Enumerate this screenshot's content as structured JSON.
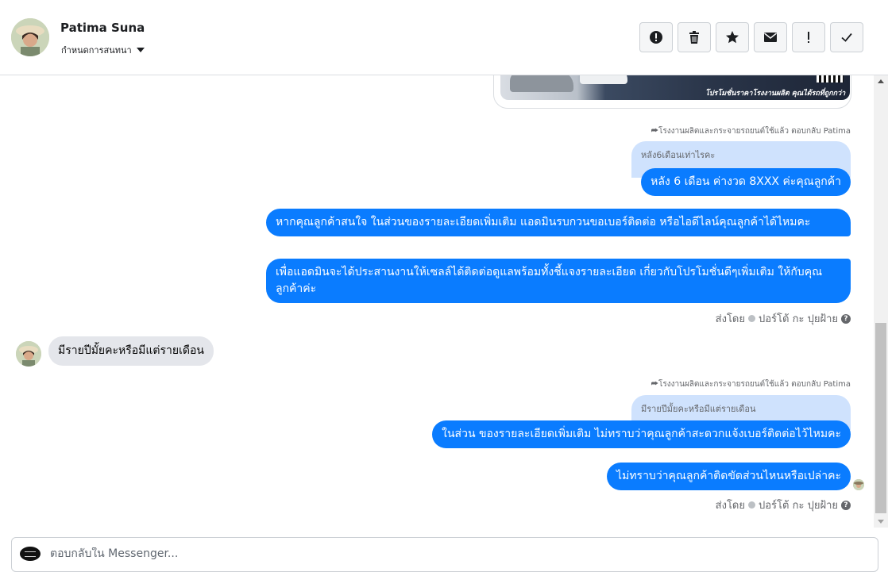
{
  "header": {
    "name": "Patima Suna",
    "assign_label": "กำหนดการสนทนา",
    "toolbar": [
      {
        "icon": "alert-circle-icon",
        "label": "Mark as spam"
      },
      {
        "icon": "trash-icon",
        "label": "Delete"
      },
      {
        "icon": "star-icon",
        "label": "Star"
      },
      {
        "icon": "envelope-icon",
        "label": "Mark as unread"
      },
      {
        "icon": "exclamation-icon",
        "label": "Follow up"
      },
      {
        "icon": "check-icon",
        "label": "Mark as done"
      }
    ]
  },
  "image_card": {
    "caption": "โปรโมชั่นราคาโรงงานผลิต คุณได้รถที่ถูกกว่า"
  },
  "messages": {
    "reply_note_1": "โรงงานผลิตและกระจายรถยนต์ใช้แล้ว ตอบกลับ Patima",
    "quoted_1": "หลัง6เดือนเท่าไรคะ",
    "out_1": "หลัง 6 เดือน ค่างวด 8XXX ค่ะคุณลูกค้า",
    "out_2": "หากคุณลูกค้าสนใจ ในส่วนของรายละเอียดเพิ่มเติม แอดมินรบกวนขอเบอร์ติดต่อ หรือไอดีไลน์คุณลูกค้าได้ไหมคะ",
    "out_3": "เพื่อแอดมินจะได้ประสานงานให้เซลล์ได้ติดต่อดูแลพร้อมทั้งชี้แจงรายละเอียด เกี่ยวกับโปรโมชั่นดีๆเพิ่มเติม ให้กับคุณลูกค้าค่ะ",
    "sent_by_1": "ส่งโดย",
    "sender_1": "ปอร์โต้ กะ ปุยฝ้าย",
    "in_1": "มีรายปีมั้ยคะหรือมีแต่รายเดือน",
    "reply_note_2": "โรงงานผลิตและกระจายรถยนต์ใช้แล้ว ตอบกลับ Patima",
    "quoted_2": "มีรายปีมั้ยคะหรือมีแต่รายเดือน",
    "out_4": "ในส่วน ของรายละเอียดเพิ่มเติม ไม่ทราบว่าคุณลูกค้าสะดวกแจ้งเบอร์ติดต่อไว้ไหมคะ",
    "out_5": "ไม่ทราบว่าคุณลูกค้าติดขัดส่วนไหนหรือเปล่าคะ",
    "sent_by_2": "ส่งโดย",
    "sender_2": "ปอร์โต้ กะ ปุยฝ้าย"
  },
  "composer": {
    "placeholder": "ตอบกลับใน Messenger..."
  },
  "colors": {
    "outgoing_bubble": "#0a7cff",
    "incoming_bubble": "#e4e6eb",
    "quoted_bubble": "#cfe2fd"
  }
}
